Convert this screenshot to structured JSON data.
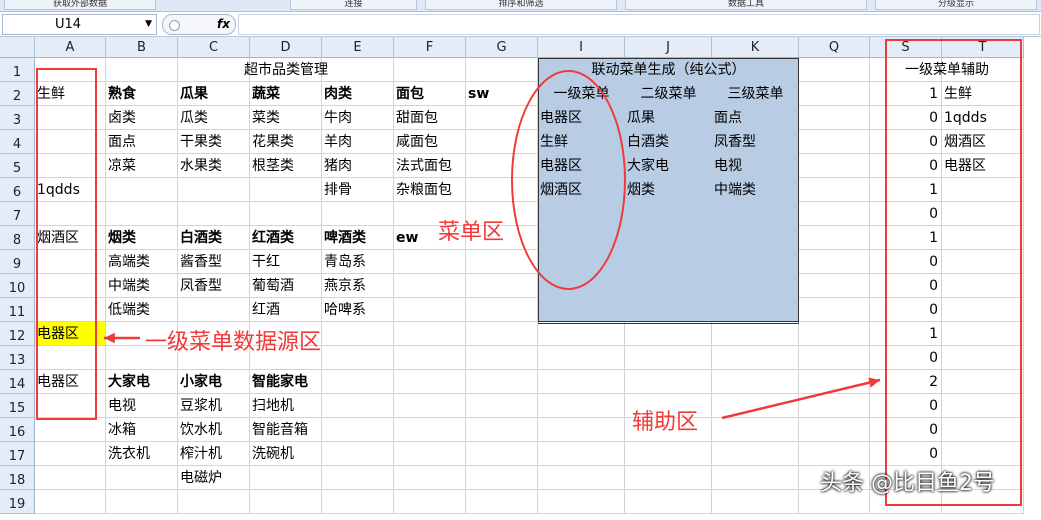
{
  "ribbon": {
    "buttons": [
      "获取外部数据",
      "连接",
      "排序和筛选",
      "数据工具",
      "分级显示"
    ]
  },
  "formula_bar": {
    "name_box": "U14",
    "fx_label": "fx",
    "formula": ""
  },
  "columns": [
    "A",
    "B",
    "C",
    "D",
    "E",
    "F",
    "G",
    "I",
    "J",
    "K",
    "Q",
    "S",
    "T"
  ],
  "rows": [
    "1",
    "2",
    "3",
    "4",
    "5",
    "6",
    "7",
    "8",
    "9",
    "10",
    "11",
    "12",
    "13",
    "14",
    "15",
    "16",
    "17",
    "18",
    "19"
  ],
  "cells": {
    "title": "超市品类管理",
    "A2": "生鲜",
    "A6": "1qdds",
    "A8": "烟酒区",
    "A12": "电器区",
    "A14": "电器区",
    "B2": "熟食",
    "C2": "瓜果",
    "D2": "蔬菜",
    "E2": "肉类",
    "F2": "面包",
    "G2": "sw",
    "B3": "卤类",
    "C3": "瓜类",
    "D3": "菜类",
    "E3": "牛肉",
    "F3": "甜面包",
    "B4": "面点",
    "C4": "干果类",
    "D4": "花果类",
    "E4": "羊肉",
    "F4": "咸面包",
    "B5": "凉菜",
    "C5": "水果类",
    "D5": "根茎类",
    "E5": "猪肉",
    "F5": "法式面包",
    "E6": "排骨",
    "F6": "杂粮面包",
    "B8": "烟类",
    "C8": "白酒类",
    "D8": "红酒类",
    "E8": "啤酒类",
    "F8": "ew",
    "B9": "高端类",
    "C9": "酱香型",
    "D9": "干红",
    "E9": "青岛系",
    "B10": "中端类",
    "C10": "凤香型",
    "D10": "葡萄酒",
    "E10": "燕京系",
    "B11": "低端类",
    "D11": "红酒",
    "E11": "哈啤系",
    "B14": "大家电",
    "C14": "小家电",
    "D14": "智能家电",
    "B15": "电视",
    "C15": "豆浆机",
    "D15": "扫地机",
    "B16": "冰箱",
    "C16": "饮水机",
    "D16": "智能音箱",
    "B17": "洗衣机",
    "C17": "榨汁机",
    "D17": "洗碗机",
    "C18": "电磁炉"
  },
  "menu": {
    "title": "联动菜单生成（纯公式）",
    "headers": [
      "一级菜单",
      "二级菜单",
      "三级菜单"
    ],
    "rows": [
      [
        "电器区",
        "瓜果",
        "面点"
      ],
      [
        "生鲜",
        "白酒类",
        "凤香型"
      ],
      [
        "电器区",
        "大家电",
        "电视"
      ],
      [
        "烟酒区",
        "烟类",
        "中端类"
      ]
    ]
  },
  "aux": {
    "title": "一级菜单辅助",
    "s_values": [
      "1",
      "0",
      "0",
      "0",
      "1",
      "0",
      "1",
      "0",
      "0",
      "0",
      "1",
      "0",
      "2",
      "0",
      "0",
      "0"
    ],
    "t_values": [
      "生鲜",
      "1qdds",
      "烟酒区",
      "电器区"
    ]
  },
  "annotations": {
    "menu_area": "菜单区",
    "source_area": "一级菜单数据源区",
    "aux_area": "辅助区"
  },
  "watermark": "头条 @比目鱼2号",
  "colors": {
    "menu_fill": "#b8cce4",
    "highlight": "#ffff00",
    "annotation": "#f03a3a"
  }
}
